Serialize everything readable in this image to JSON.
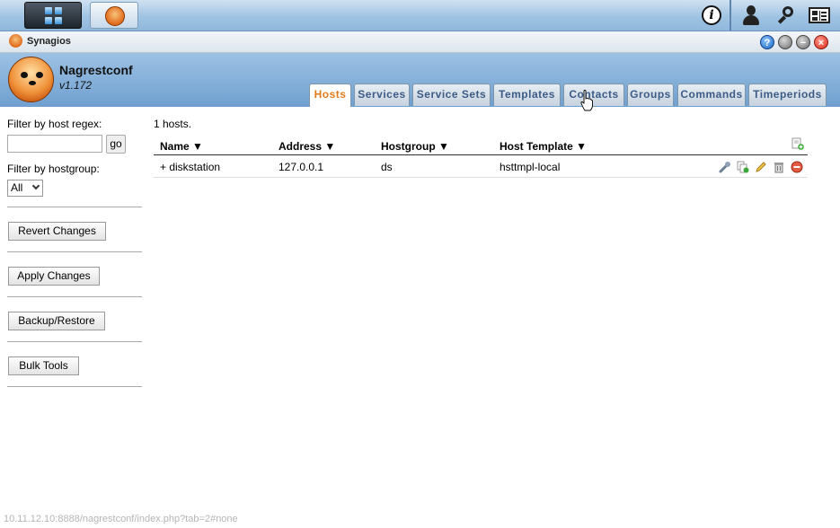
{
  "taskbar": {
    "main_menu_icon": "grid-icon",
    "app_icon": "meerkat-icon",
    "info_icon": "info-icon",
    "user_icon": "user-icon",
    "search_icon": "search-icon",
    "layout_icon": "layout-icon"
  },
  "window": {
    "title": "Synagios",
    "help": "?",
    "close": "×"
  },
  "app": {
    "name": "Nagrestconf",
    "version": "v1.172"
  },
  "tabs": [
    {
      "label": "Hosts",
      "active": true
    },
    {
      "label": "Services"
    },
    {
      "label": "Service Sets"
    },
    {
      "label": "Templates"
    },
    {
      "label": "Contacts"
    },
    {
      "label": "Groups"
    },
    {
      "label": "Commands"
    },
    {
      "label": "Timeperiods"
    }
  ],
  "sidebar": {
    "filter_regex_label": "Filter by host regex:",
    "filter_regex_value": "",
    "go_label": "go",
    "filter_group_label": "Filter by hostgroup:",
    "filter_group_value": "All",
    "revert": "Revert Changes",
    "apply": "Apply Changes",
    "backup": "Backup/Restore",
    "bulk": "Bulk Tools"
  },
  "main": {
    "count": "1 hosts.",
    "columns": [
      "Name ▼",
      "Address ▼",
      "Hostgroup ▼",
      "Host Template ▼"
    ],
    "rows": [
      {
        "name": "+ diskstation",
        "address": "127.0.0.1",
        "hostgroup": "ds",
        "template": "hsttmpl-local"
      }
    ],
    "row_actions": [
      "wrench-icon",
      "clone-icon",
      "edit-icon",
      "delete-icon",
      "disable-icon"
    ],
    "add_icon": "add-host-icon"
  },
  "statusbar": {
    "url": "10.11.12.10:8888/nagrestconf/index.php?tab=2#none"
  }
}
